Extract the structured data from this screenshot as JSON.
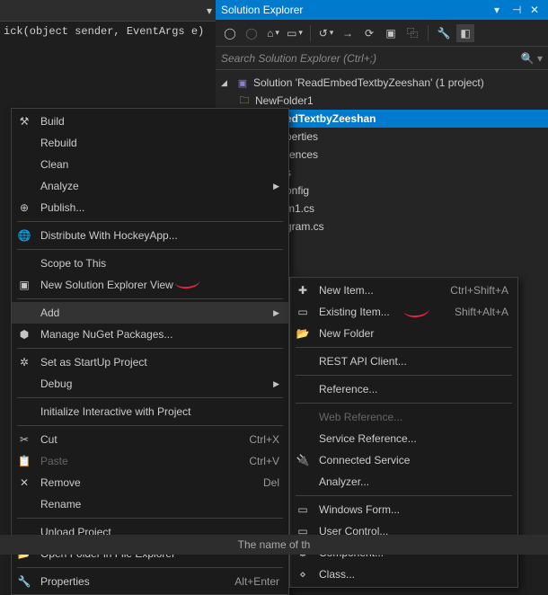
{
  "editor": {
    "dropdown_line": "ick(object sender, EventArgs e)"
  },
  "panel": {
    "title": "Solution Explorer",
    "search_placeholder": "Search Solution Explorer (Ctrl+;)"
  },
  "tree": {
    "solution": "Solution 'ReadEmbedTextbyZeeshan' (1 project)",
    "items": [
      {
        "label": "NewFolder1"
      },
      {
        "label": "mbedTextbyZeeshan"
      },
      {
        "label": "perties"
      },
      {
        "label": "rences"
      },
      {
        "label": "s"
      },
      {
        "label": "p.config"
      },
      {
        "label": "m1.cs"
      },
      {
        "label": "gram.cs"
      }
    ]
  },
  "status": "The name of th",
  "menu": {
    "items": [
      {
        "label": "Build",
        "icon": "build"
      },
      {
        "label": "Rebuild"
      },
      {
        "label": "Clean"
      },
      {
        "label": "Analyze",
        "submenu": true
      },
      {
        "label": "Publish...",
        "icon": "publish",
        "sep_after": true
      },
      {
        "label": "Distribute With HockeyApp...",
        "icon": "globe",
        "sep_after": true
      },
      {
        "label": "Scope to This"
      },
      {
        "label": "New Solution Explorer View",
        "icon": "window",
        "sep_after": true
      },
      {
        "label": "Add",
        "submenu": true,
        "highlight": true
      },
      {
        "label": "Manage NuGet Packages...",
        "icon": "nuget",
        "sep_after": true
      },
      {
        "label": "Set as StartUp Project",
        "icon": "gear"
      },
      {
        "label": "Debug",
        "submenu": true,
        "sep_after": true
      },
      {
        "label": "Initialize Interactive with Project",
        "sep_after": true
      },
      {
        "label": "Cut",
        "shortcut": "Ctrl+X",
        "icon": "cut"
      },
      {
        "label": "Paste",
        "shortcut": "Ctrl+V",
        "icon": "paste",
        "disabled": true
      },
      {
        "label": "Remove",
        "shortcut": "Del",
        "icon": "remove"
      },
      {
        "label": "Rename",
        "sep_after": true
      },
      {
        "label": "Unload Project"
      },
      {
        "label": "Open Folder in File Explorer",
        "icon": "folder",
        "sep_after": true
      },
      {
        "label": "Properties",
        "shortcut": "Alt+Enter",
        "icon": "wrench"
      }
    ]
  },
  "submenu": {
    "items": [
      {
        "label": "New Item...",
        "shortcut": "Ctrl+Shift+A",
        "icon": "newitem"
      },
      {
        "label": "Existing Item...",
        "shortcut": "Shift+Alt+A",
        "icon": "existitem"
      },
      {
        "label": "New Folder",
        "icon": "folder",
        "sep_after": true
      },
      {
        "label": "REST API Client...",
        "sep_after": true
      },
      {
        "label": "Reference...",
        "sep_after": true
      },
      {
        "label": "Web Reference...",
        "disabled": true
      },
      {
        "label": "Service Reference..."
      },
      {
        "label": "Connected Service",
        "icon": "plug"
      },
      {
        "label": "Analyzer...",
        "sep_after": true
      },
      {
        "label": "Windows Form...",
        "icon": "form"
      },
      {
        "label": "User Control...",
        "icon": "usercontrol"
      },
      {
        "label": "Component...",
        "icon": "component"
      },
      {
        "label": "Class...",
        "icon": "class"
      }
    ]
  }
}
